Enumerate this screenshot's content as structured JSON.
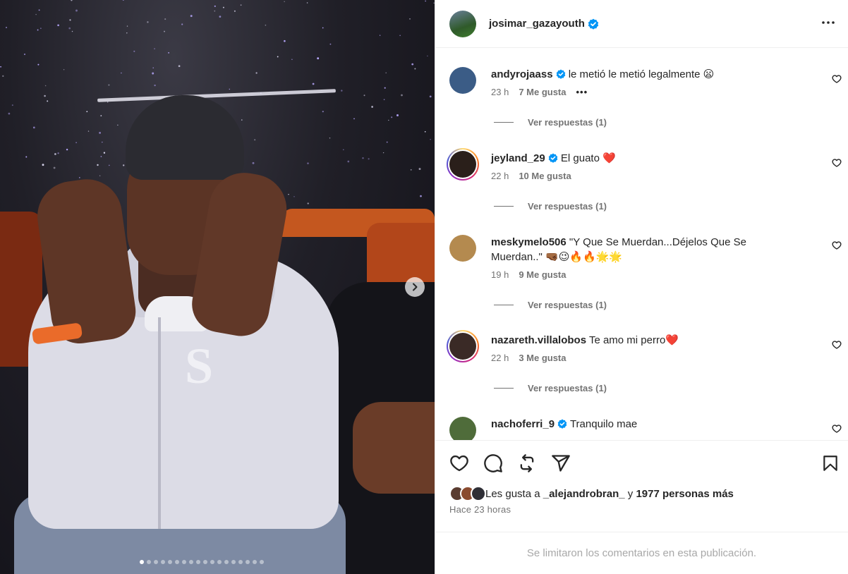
{
  "post": {
    "owner_username": "josimar_gazayouth",
    "owner_verified": true,
    "carousel_count": 18,
    "carousel_active_index": 0
  },
  "comments": [
    {
      "username": "andyrojaass",
      "verified": true,
      "text": "le metió le metió legalmente 😦",
      "time": "23 h",
      "likes": "7 Me gusta",
      "more": "•••",
      "replies": "Ver respuestas (1)",
      "avatar_color": "#3b5c86",
      "story_ring": false
    },
    {
      "username": "jeyland_29",
      "verified": true,
      "text": "El guato ❤️",
      "time": "22 h",
      "likes": "10 Me gusta",
      "replies": "Ver respuestas (1)",
      "avatar_color": "#2a1f1a",
      "story_ring": true
    },
    {
      "username": "meskymelo506",
      "verified": false,
      "text": "\"Y Que Se Muerdan...Déjelos Que Se Muerdan..\" 🤜🏾😉🔥🔥🌟🌟",
      "time": "19 h",
      "likes": "9 Me gusta",
      "replies": "Ver respuestas (1)",
      "avatar_color": "#b48a4f",
      "story_ring": false
    },
    {
      "username": "nazareth.villalobos",
      "verified": false,
      "text": "Te amo mi perro❤️",
      "time": "22 h",
      "likes": "3 Me gusta",
      "replies": "Ver respuestas (1)",
      "avatar_color": "#3a2a26",
      "story_ring": true
    },
    {
      "username": "nachoferri_9",
      "verified": true,
      "text": "Tranquilo mae",
      "avatar_color": "#4f6c3a",
      "story_ring": false
    }
  ],
  "likes_summary": {
    "prefix": "Les gusta a ",
    "first_user": "_alejandrobran_",
    "joiner": " y ",
    "others": "1977 personas más"
  },
  "posted_ago": "Hace 23 horas",
  "comments_limited_notice": "Se limitaron los comentarios en esta publicación.",
  "colors": {
    "verified_badge": "#0095f6",
    "secondary_text": "#737373",
    "primary_text": "#262626"
  }
}
